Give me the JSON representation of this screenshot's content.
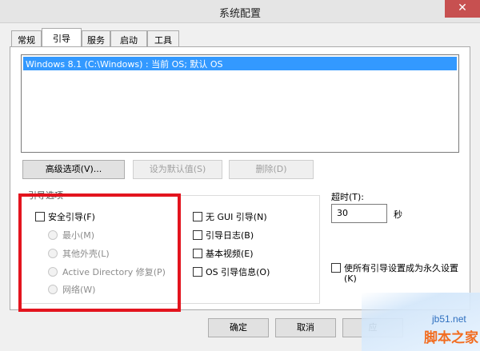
{
  "window": {
    "title": "系统配置",
    "close_label": "✕"
  },
  "tabs": [
    {
      "label": "常规",
      "active": false
    },
    {
      "label": "引导",
      "active": true
    },
    {
      "label": "服务",
      "active": false
    },
    {
      "label": "启动",
      "active": false
    },
    {
      "label": "工具",
      "active": false
    }
  ],
  "boot_list": {
    "selected_entry": "Windows 8.1 (C:\\Windows) : 当前 OS; 默认 OS"
  },
  "buttons": {
    "advanced": "高级选项(V)...",
    "set_default": "设为默认值(S)",
    "delete": "删除(D)",
    "ok": "确定",
    "cancel": "取消",
    "apply": "应"
  },
  "boot_options": {
    "group_label": "引导选项",
    "safe_boot": "安全引导(F)",
    "minimal": "最小(M)",
    "alternate_shell": "其他外壳(L)",
    "ad_repair": "Active Directory 修复(P)",
    "network": "网络(W)",
    "no_gui": "无 GUI 引导(N)",
    "boot_log": "引导日志(B)",
    "base_video": "基本视频(E)",
    "os_boot_info": "OS 引导信息(O)"
  },
  "timeout": {
    "label": "超时(T):",
    "value": "30",
    "unit": "秒"
  },
  "make_permanent": {
    "line1": "使所有引导设置成为永久设置",
    "line2": "(K)"
  },
  "watermark": {
    "site": "jb51.net",
    "name": "脚本之家"
  },
  "colors": {
    "selection": "#3399ff",
    "highlight_box": "#e3141e",
    "close_button": "#c75050"
  }
}
